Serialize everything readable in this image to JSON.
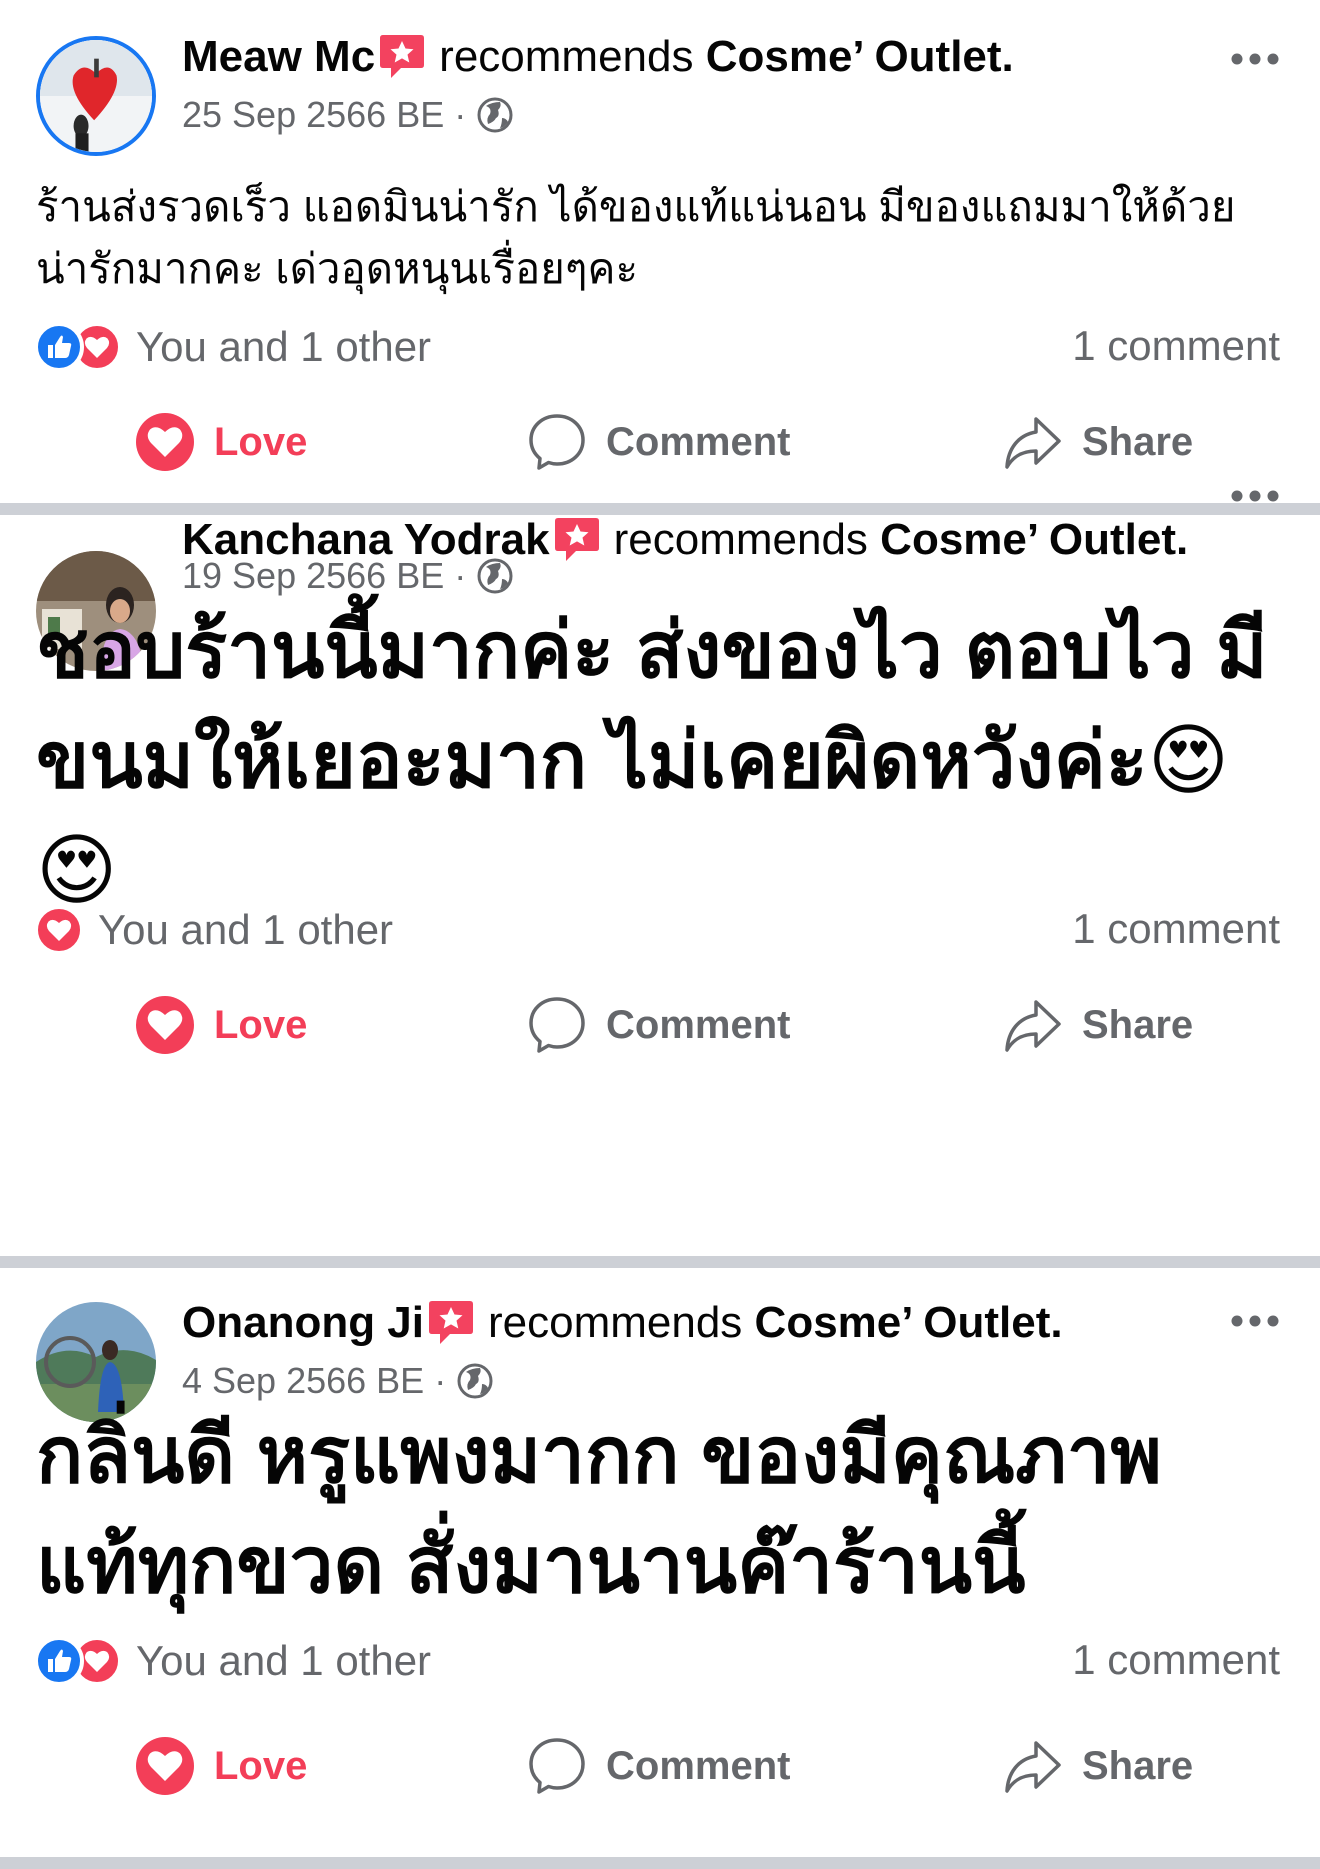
{
  "posts": [
    {
      "author": "Meaw Mc",
      "recommends": "recommends",
      "page": "Cosme’ Outlet.",
      "date": "25 Sep 2566 BE",
      "sep": "·",
      "text": "ร้านส่งรวดเร็ว แอดมินน่ารัก ได้ของแท้แน่นอน มีของแถมมาให้ด้วย น่ารักมากคะ เด่วอุดหนุนเรื่อยๆคะ",
      "reactions_text": "You and 1 other",
      "comments": "1 comment"
    },
    {
      "author": "Kanchana Yodrak",
      "recommends": "recommends",
      "page": "Cosme’ Outlet.",
      "date": "19 Sep 2566 BE",
      "sep": "·",
      "text": "ชอบร้านนี้มากค่ะ ส่งของไว ตอบไว มีขนมให้เยอะมาก ไม่เคยผิดหวังค่ะ😍😍",
      "reactions_text": "You and 1 other",
      "comments": "1 comment"
    },
    {
      "author": "Onanong Ji",
      "recommends": "recommends",
      "page": "Cosme’ Outlet.",
      "date": "4 Sep 2566 BE",
      "sep": "·",
      "text": "กลิ่นดี หรูแพงมากก ของมีคุณภาพ แท้ทุกขวด สั่งมานานค๊าร้านนี้",
      "reactions_text": "You and 1 other",
      "comments": "1 comment"
    }
  ],
  "actions": {
    "love": "Love",
    "comment": "Comment",
    "share": "Share"
  },
  "icons": {
    "recommend": "recommend-star-icon",
    "globe": "globe-icon",
    "more": "more-dots-icon",
    "like": "like-reaction-icon",
    "love": "love-reaction-icon",
    "comment": "comment-icon",
    "share": "share-icon"
  },
  "colors": {
    "love_red": "#f33e58",
    "like_blue": "#1877f2",
    "recommend_red": "#f3425f",
    "secondary_text": "#65676b",
    "divider": "#cdd0d6"
  }
}
